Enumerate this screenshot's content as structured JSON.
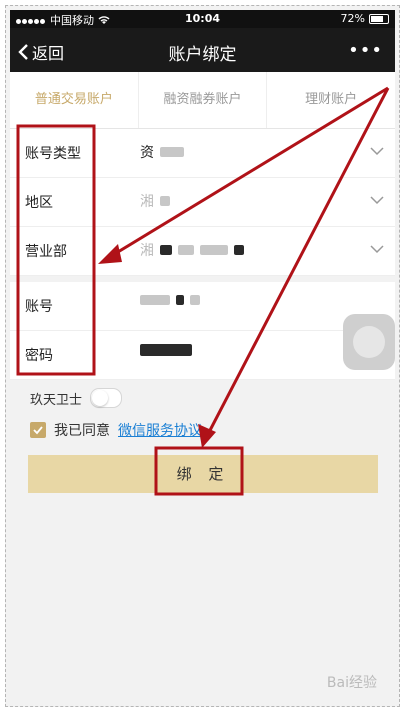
{
  "status_bar": {
    "carrier": "中国移动",
    "time": "10:04",
    "battery": "72%"
  },
  "nav": {
    "back_label": "返回",
    "title": "账户绑定",
    "more_label": "•••"
  },
  "tabs": [
    {
      "label": "普通交易账户",
      "active": true
    },
    {
      "label": "融资融券账户",
      "active": false
    },
    {
      "label": "理财账户",
      "active": false
    }
  ],
  "form": {
    "account_type": {
      "label": "账号类型",
      "value": "资"
    },
    "region": {
      "label": "地区",
      "value": "湘"
    },
    "branch": {
      "label": "营业部",
      "value": "湘"
    },
    "account": {
      "label": "账号"
    },
    "password": {
      "label": "密码"
    }
  },
  "security": {
    "label": "玖天卫士",
    "enabled": false
  },
  "agreement": {
    "prefix": "我已同意",
    "link": "微信服务协议",
    "checked": true
  },
  "bind_button": {
    "label": "绑 定"
  },
  "colors": {
    "accent_gold": "#c7a96a",
    "button_bg": "#e8d7a5",
    "annotation_red": "#b01218",
    "nav_bg": "#1a1a1a"
  },
  "watermark": "Bai经验"
}
